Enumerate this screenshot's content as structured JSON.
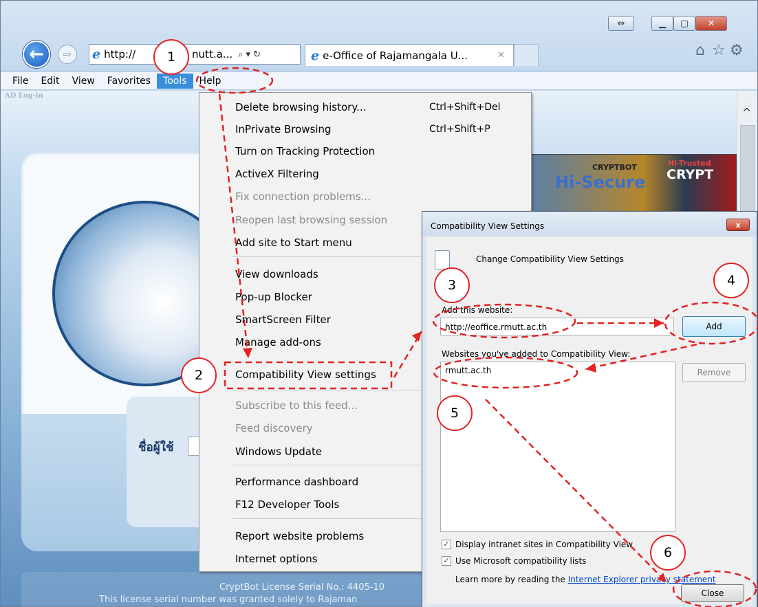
{
  "browser": {
    "address_text": "http://",
    "address_tail": "nutt.a...",
    "address_controls": "⌕ ▾ ↻",
    "tab_title": "e-Office of Rajamangala U...",
    "tab_close": "✕",
    "icons": [
      "back-icon",
      "forward-icon",
      "home-icon",
      "favorites-star-icon",
      "tools-gear-icon",
      "restore-icon",
      "minimize-icon",
      "maximize-icon",
      "close-icon"
    ]
  },
  "menubar": {
    "items": [
      "File",
      "Edit",
      "View",
      "Favorites",
      "Tools",
      "Help"
    ]
  },
  "page": {
    "ad_login": "AD Log-in",
    "user_label": "ชื่อผู้ใช้",
    "banner_brand": "CRYPTBOT",
    "banner_secure": "Hi-Secure",
    "banner_trusted": "Hi-Trusted",
    "banner_crypt": "CRYPT",
    "license_line1": "CryptBot License Serial No.: 4405-10",
    "license_line2": "This license serial number was granted solely to Rajaman"
  },
  "tools_menu": {
    "items": [
      {
        "label": "Delete browsing history...",
        "shortcut": "Ctrl+Shift+Del",
        "disabled": false
      },
      {
        "label": "InPrivate Browsing",
        "shortcut": "Ctrl+Shift+P",
        "disabled": false
      },
      {
        "label": "Turn on Tracking Protection",
        "shortcut": "",
        "disabled": false
      },
      {
        "label": "ActiveX Filtering",
        "shortcut": "",
        "disabled": false
      },
      {
        "label": "Fix connection problems...",
        "shortcut": "",
        "disabled": true
      },
      {
        "label": "Reopen last browsing session",
        "shortcut": "",
        "disabled": true
      },
      {
        "label": "Add site to Start menu",
        "shortcut": "",
        "disabled": false
      },
      {
        "label": "View downloads",
        "shortcut": "",
        "disabled": false
      },
      {
        "label": "Pop-up Blocker",
        "shortcut": "",
        "disabled": false
      },
      {
        "label": "SmartScreen Filter",
        "shortcut": "",
        "disabled": false
      },
      {
        "label": "Manage add-ons",
        "shortcut": "",
        "disabled": false
      },
      {
        "label": "Compatibility View settings",
        "shortcut": "",
        "disabled": false
      },
      {
        "label": "Subscribe to this feed...",
        "shortcut": "",
        "disabled": true
      },
      {
        "label": "Feed discovery",
        "shortcut": "",
        "disabled": true
      },
      {
        "label": "Windows Update",
        "shortcut": "",
        "disabled": false
      },
      {
        "label": "Performance dashboard",
        "shortcut": "",
        "disabled": false
      },
      {
        "label": "F12 Developer Tools",
        "shortcut": "",
        "disabled": false
      },
      {
        "label": "Report website problems",
        "shortcut": "",
        "disabled": false
      },
      {
        "label": "Internet options",
        "shortcut": "",
        "disabled": false
      }
    ]
  },
  "dialog": {
    "title": "Compatibility View Settings",
    "close": "x",
    "header": "Change Compatibility View Settings",
    "add_label": "Add this website:",
    "add_value": "http://eoffice.rmutt.ac.th",
    "add_button": "Add",
    "list_label": "Websites you've added to Compatibility View:",
    "list_items": [
      "rmutt.ac.th"
    ],
    "remove_button": "Remove",
    "check_intranet": "Display intranet sites in Compatibility View",
    "check_ms_lists": "Use Microsoft compatibility lists",
    "check_intranet_checked": true,
    "check_ms_lists_checked": true,
    "learn_prefix": "Learn more by reading the",
    "learn_link": "Internet Explorer privacy statement",
    "close_button": "Close"
  },
  "annotations": [
    "1",
    "2",
    "3",
    "4",
    "5",
    "6"
  ],
  "colors": {
    "annotation": "#e32222",
    "accent": "#3a8edb"
  }
}
